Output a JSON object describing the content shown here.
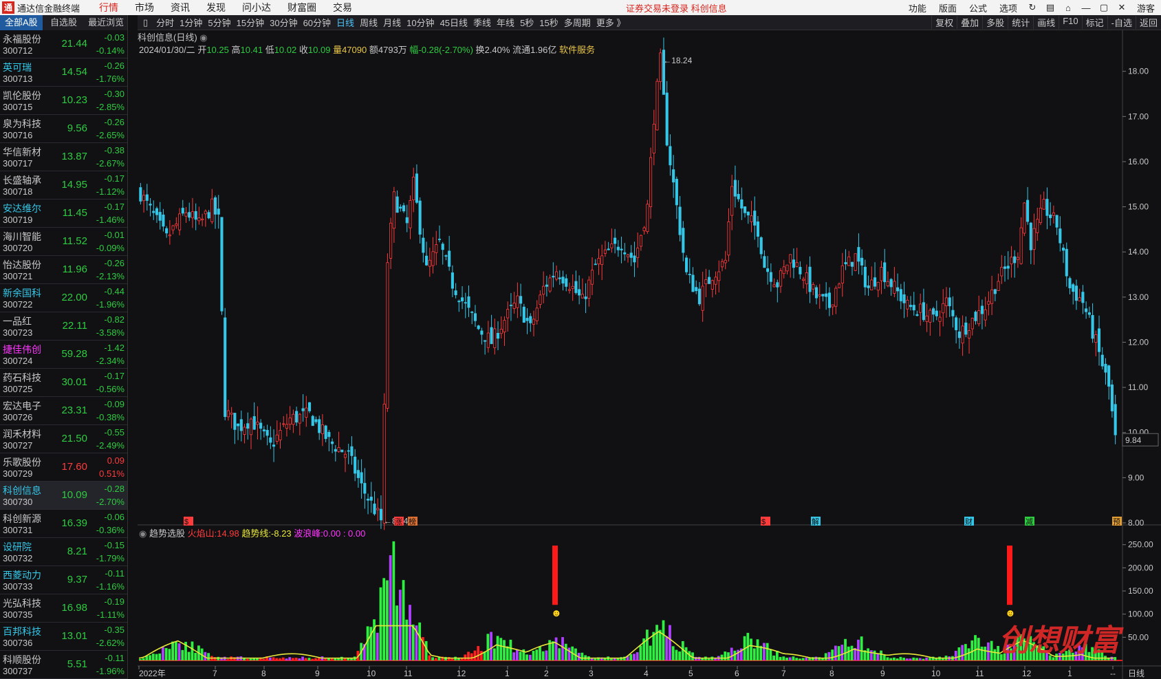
{
  "app": {
    "title": "通达信金融终端",
    "logo_glyph": "通"
  },
  "menu": {
    "tabs": [
      "行情",
      "市场",
      "资讯",
      "发现",
      "问小达",
      "财富圈",
      "交易"
    ],
    "active": "行情",
    "notice": "证券交易未登录   科创信息",
    "right_buttons": [
      "功能",
      "版面",
      "公式",
      "选项"
    ],
    "right_icons": [
      "refresh-icon",
      "save-icon",
      "lock-icon",
      "minimize-icon",
      "maximize-icon",
      "close-icon"
    ],
    "guest": "游客"
  },
  "sidebar": {
    "tabs": [
      "全部A股",
      "自选股",
      "最近浏览"
    ],
    "stocks": [
      {
        "name": "永福股份",
        "code": "300712",
        "price": "21.44",
        "change": "-0.03",
        "pct": "-0.14%",
        "name_color": "#c8c8c8",
        "trend": "down"
      },
      {
        "name": "英可瑞",
        "code": "300713",
        "price": "14.54",
        "change": "-0.26",
        "pct": "-1.76%",
        "name_color": "#35c7e8",
        "trend": "down"
      },
      {
        "name": "凯伦股份",
        "code": "300715",
        "price": "10.23",
        "change": "-0.30",
        "pct": "-2.85%",
        "name_color": "#c8c8c8",
        "trend": "down"
      },
      {
        "name": "泉为科技",
        "code": "300716",
        "price": "9.56",
        "change": "-0.26",
        "pct": "-2.65%",
        "name_color": "#c8c8c8",
        "trend": "down"
      },
      {
        "name": "华信新材",
        "code": "300717",
        "price": "13.87",
        "change": "-0.38",
        "pct": "-2.67%",
        "name_color": "#c8c8c8",
        "trend": "down"
      },
      {
        "name": "长盛轴承",
        "code": "300718",
        "price": "14.95",
        "change": "-0.17",
        "pct": "-1.12%",
        "name_color": "#c8c8c8",
        "trend": "down"
      },
      {
        "name": "安达维尔",
        "code": "300719",
        "price": "11.45",
        "change": "-0.17",
        "pct": "-1.46%",
        "name_color": "#35c7e8",
        "trend": "down"
      },
      {
        "name": "海川智能",
        "code": "300720",
        "price": "11.52",
        "change": "-0.01",
        "pct": "-0.09%",
        "name_color": "#c8c8c8",
        "trend": "down"
      },
      {
        "name": "怡达股份",
        "code": "300721",
        "price": "11.96",
        "change": "-0.26",
        "pct": "-2.13%",
        "name_color": "#c8c8c8",
        "trend": "down"
      },
      {
        "name": "新余国科",
        "code": "300722",
        "price": "22.00",
        "change": "-0.44",
        "pct": "-1.96%",
        "name_color": "#35c7e8",
        "trend": "down"
      },
      {
        "name": "一品红",
        "code": "300723",
        "price": "22.11",
        "change": "-0.82",
        "pct": "-3.58%",
        "name_color": "#c8c8c8",
        "trend": "down"
      },
      {
        "name": "捷佳伟创",
        "code": "300724",
        "price": "59.28",
        "change": "-1.42",
        "pct": "-2.34%",
        "name_color": "#ff36ff",
        "trend": "down"
      },
      {
        "name": "药石科技",
        "code": "300725",
        "price": "30.01",
        "change": "-0.17",
        "pct": "-0.56%",
        "name_color": "#c8c8c8",
        "trend": "down"
      },
      {
        "name": "宏达电子",
        "code": "300726",
        "price": "23.31",
        "change": "-0.09",
        "pct": "-0.38%",
        "name_color": "#c8c8c8",
        "trend": "down"
      },
      {
        "name": "润禾材料",
        "code": "300727",
        "price": "21.50",
        "change": "-0.55",
        "pct": "-2.49%",
        "name_color": "#c8c8c8",
        "trend": "down"
      },
      {
        "name": "乐歌股份",
        "code": "300729",
        "price": "17.60",
        "change": "0.09",
        "pct": "0.51%",
        "name_color": "#c8c8c8",
        "trend": "up"
      },
      {
        "name": "科创信息",
        "code": "300730",
        "price": "10.09",
        "change": "-0.28",
        "pct": "-2.70%",
        "name_color": "#35c7e8",
        "trend": "down",
        "selected": true
      },
      {
        "name": "科创新源",
        "code": "300731",
        "price": "16.39",
        "change": "-0.06",
        "pct": "-0.36%",
        "name_color": "#c8c8c8",
        "trend": "down"
      },
      {
        "name": "设研院",
        "code": "300732",
        "price": "8.21",
        "change": "-0.15",
        "pct": "-1.79%",
        "name_color": "#35c7e8",
        "trend": "down"
      },
      {
        "name": "西菱动力",
        "code": "300733",
        "price": "9.37",
        "change": "-0.11",
        "pct": "-1.16%",
        "name_color": "#35c7e8",
        "trend": "down"
      },
      {
        "name": "光弘科技",
        "code": "300735",
        "price": "16.98",
        "change": "-0.19",
        "pct": "-1.11%",
        "name_color": "#c8c8c8",
        "trend": "down"
      },
      {
        "name": "百邦科技",
        "code": "300736",
        "price": "13.01",
        "change": "-0.35",
        "pct": "-2.62%",
        "name_color": "#35c7e8",
        "trend": "down"
      },
      {
        "name": "科顺股份",
        "code": "300737",
        "price": "5.51",
        "change": "-0.11",
        "pct": "-1.96%",
        "name_color": "#c8c8c8",
        "trend": "down"
      }
    ]
  },
  "periodbar": {
    "tabs": [
      "分时",
      "1分钟",
      "5分钟",
      "15分钟",
      "30分钟",
      "60分钟",
      "日线",
      "周线",
      "月线",
      "10分钟",
      "45日线",
      "季线",
      "年线",
      "5秒",
      "15秒",
      "多周期",
      "更多 》"
    ],
    "active": "日线",
    "right": [
      "复权",
      "叠加",
      "多股",
      "统计",
      "画线",
      "F10",
      "标记",
      "-自选",
      "返回"
    ]
  },
  "chart_header": {
    "title": "科创信息(日线)",
    "date": "2024/01/30/二",
    "open_label": "开",
    "open": "10.25",
    "high_label": "高",
    "high": "10.41",
    "low_label": "低",
    "low": "10.02",
    "close_label": "收",
    "close": "10.09",
    "vol_label": "量",
    "vol": "47090",
    "amt_label": "额",
    "amt": "4793万",
    "amp_label": "幅",
    "amp": "-0.28(-2.70%)",
    "turn_label": "换",
    "turn": "2.40%",
    "float_label": "流通",
    "float": "1.96亿",
    "sector": "软件服务"
  },
  "indicator_header": {
    "name": "趋势选股",
    "fire_label": "火焰山:",
    "fire": "14.98",
    "trend_label": "趋势线:",
    "trend": "-8.23",
    "wave_label": "波浪峰:",
    "wave": "0.00 : 0.00"
  },
  "chart_data": [
    {
      "type": "candlestick",
      "title": "科创信息(日线)",
      "ylim": [
        8.0,
        18.3
      ],
      "y_ticks": [
        "18.00",
        "17.00",
        "16.00",
        "15.00",
        "14.00",
        "13.00",
        "12.00",
        "11.00",
        "10.00",
        "9.00",
        "8.00"
      ],
      "x_ticks": [
        "2022年",
        "7",
        "8",
        "9",
        "10",
        "11",
        "12",
        "1",
        "2",
        "3",
        "4",
        "5",
        "6",
        "7",
        "8",
        "9",
        "10",
        "11",
        "12",
        "1",
        "--"
      ],
      "annotations": {
        "high": "18.24",
        "low": "8.04",
        "last": "9.84"
      },
      "event_markers": [
        "$",
        "涨",
        "榜",
        "$",
        "解",
        "财",
        "减",
        "预"
      ],
      "close_path": [
        [
          0,
          15.3
        ],
        [
          8,
          14.3
        ],
        [
          14,
          14.9
        ],
        [
          18,
          14.6
        ],
        [
          22,
          15.0
        ],
        [
          24,
          14.7
        ],
        [
          26,
          10.5
        ],
        [
          30,
          10.1
        ],
        [
          34,
          10.3
        ],
        [
          40,
          9.7
        ],
        [
          46,
          10.3
        ],
        [
          52,
          10.4
        ],
        [
          58,
          9.8
        ],
        [
          64,
          9.5
        ],
        [
          68,
          8.8
        ],
        [
          72,
          8.3
        ],
        [
          74,
          8.05
        ],
        [
          75,
          10.5
        ],
        [
          76,
          13.8
        ],
        [
          78,
          15.2
        ],
        [
          82,
          14.6
        ],
        [
          84,
          15.5
        ],
        [
          88,
          13.6
        ],
        [
          92,
          14.2
        ],
        [
          96,
          13.3
        ],
        [
          100,
          12.8
        ],
        [
          104,
          12.3
        ],
        [
          108,
          12.0
        ],
        [
          112,
          12.5
        ],
        [
          116,
          12.9
        ],
        [
          120,
          12.3
        ],
        [
          124,
          13.2
        ],
        [
          128,
          13.6
        ],
        [
          132,
          13.3
        ],
        [
          136,
          12.9
        ],
        [
          140,
          13.7
        ],
        [
          144,
          14.0
        ],
        [
          148,
          14.2
        ],
        [
          152,
          13.8
        ],
        [
          156,
          15.0
        ],
        [
          158,
          17.0
        ],
        [
          160,
          18.24
        ],
        [
          162,
          16.5
        ],
        [
          164,
          15.5
        ],
        [
          168,
          13.5
        ],
        [
          172,
          13.0
        ],
        [
          176,
          13.5
        ],
        [
          180,
          13.8
        ],
        [
          182,
          15.5
        ],
        [
          186,
          14.8
        ],
        [
          190,
          14.5
        ],
        [
          192,
          13.7
        ],
        [
          196,
          13.3
        ],
        [
          200,
          13.9
        ],
        [
          204,
          13.5
        ],
        [
          208,
          13.0
        ],
        [
          212,
          12.8
        ],
        [
          216,
          13.6
        ],
        [
          220,
          13.9
        ],
        [
          224,
          13.2
        ],
        [
          228,
          13.6
        ],
        [
          232,
          13.2
        ],
        [
          236,
          12.8
        ],
        [
          240,
          12.7
        ],
        [
          244,
          12.5
        ],
        [
          248,
          12.9
        ],
        [
          252,
          12.2
        ],
        [
          256,
          12.5
        ],
        [
          260,
          12.8
        ],
        [
          264,
          13.4
        ],
        [
          268,
          13.8
        ],
        [
          270,
          14.0
        ],
        [
          272,
          15.1
        ],
        [
          274,
          14.2
        ],
        [
          278,
          15.0
        ],
        [
          282,
          14.6
        ],
        [
          286,
          13.2
        ],
        [
          290,
          12.9
        ],
        [
          294,
          12.0
        ],
        [
          298,
          11.0
        ],
        [
          300,
          9.84
        ]
      ]
    },
    {
      "type": "bar",
      "title": "趋势选股",
      "ylim": [
        0,
        260
      ],
      "y_ticks": [
        "250.00",
        "200.00",
        "150.00",
        "100.00",
        "50.00"
      ],
      "series": [
        {
          "name": "火焰山",
          "values": []
        },
        {
          "name": "趋势线",
          "values": []
        },
        {
          "name": "波浪峰",
          "values": []
        }
      ]
    }
  ],
  "watermark": {
    "text": "创想财富",
    "sub": "95168.cn"
  },
  "status": {
    "period": "日线",
    "zoom": "--"
  }
}
